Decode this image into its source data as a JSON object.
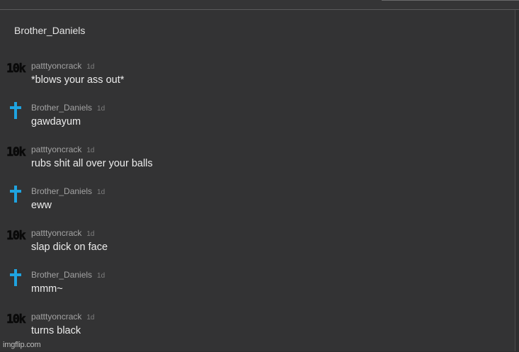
{
  "thread": {
    "title": "Brother_Daniels"
  },
  "comments": [
    {
      "author": "patttyoncrack",
      "time": "1d",
      "text": "*blows your ass out*",
      "avatar": "10k-icon",
      "avatar_text": "10k"
    },
    {
      "author": "Brother_Daniels",
      "time": "1d",
      "text": "gawdayum",
      "avatar": "cross-icon",
      "avatar_color": "#1fa3e0"
    },
    {
      "author": "patttyoncrack",
      "time": "1d",
      "text": "rubs shit all over your balls",
      "avatar": "10k-icon",
      "avatar_text": "10k"
    },
    {
      "author": "Brother_Daniels",
      "time": "1d",
      "text": "eww",
      "avatar": "cross-icon",
      "avatar_color": "#1fa3e0"
    },
    {
      "author": "patttyoncrack",
      "time": "1d",
      "text": "slap dick on face",
      "avatar": "10k-icon",
      "avatar_text": "10k"
    },
    {
      "author": "Brother_Daniels",
      "time": "1d",
      "text": "mmm~",
      "avatar": "cross-icon",
      "avatar_color": "#1fa3e0"
    },
    {
      "author": "patttyoncrack",
      "time": "1d",
      "text": "turns black",
      "avatar": "10k-icon",
      "avatar_text": "10k"
    }
  ],
  "watermark": "imgflip.com",
  "colors": {
    "background": "#333334",
    "cross": "#1fa3e0"
  }
}
